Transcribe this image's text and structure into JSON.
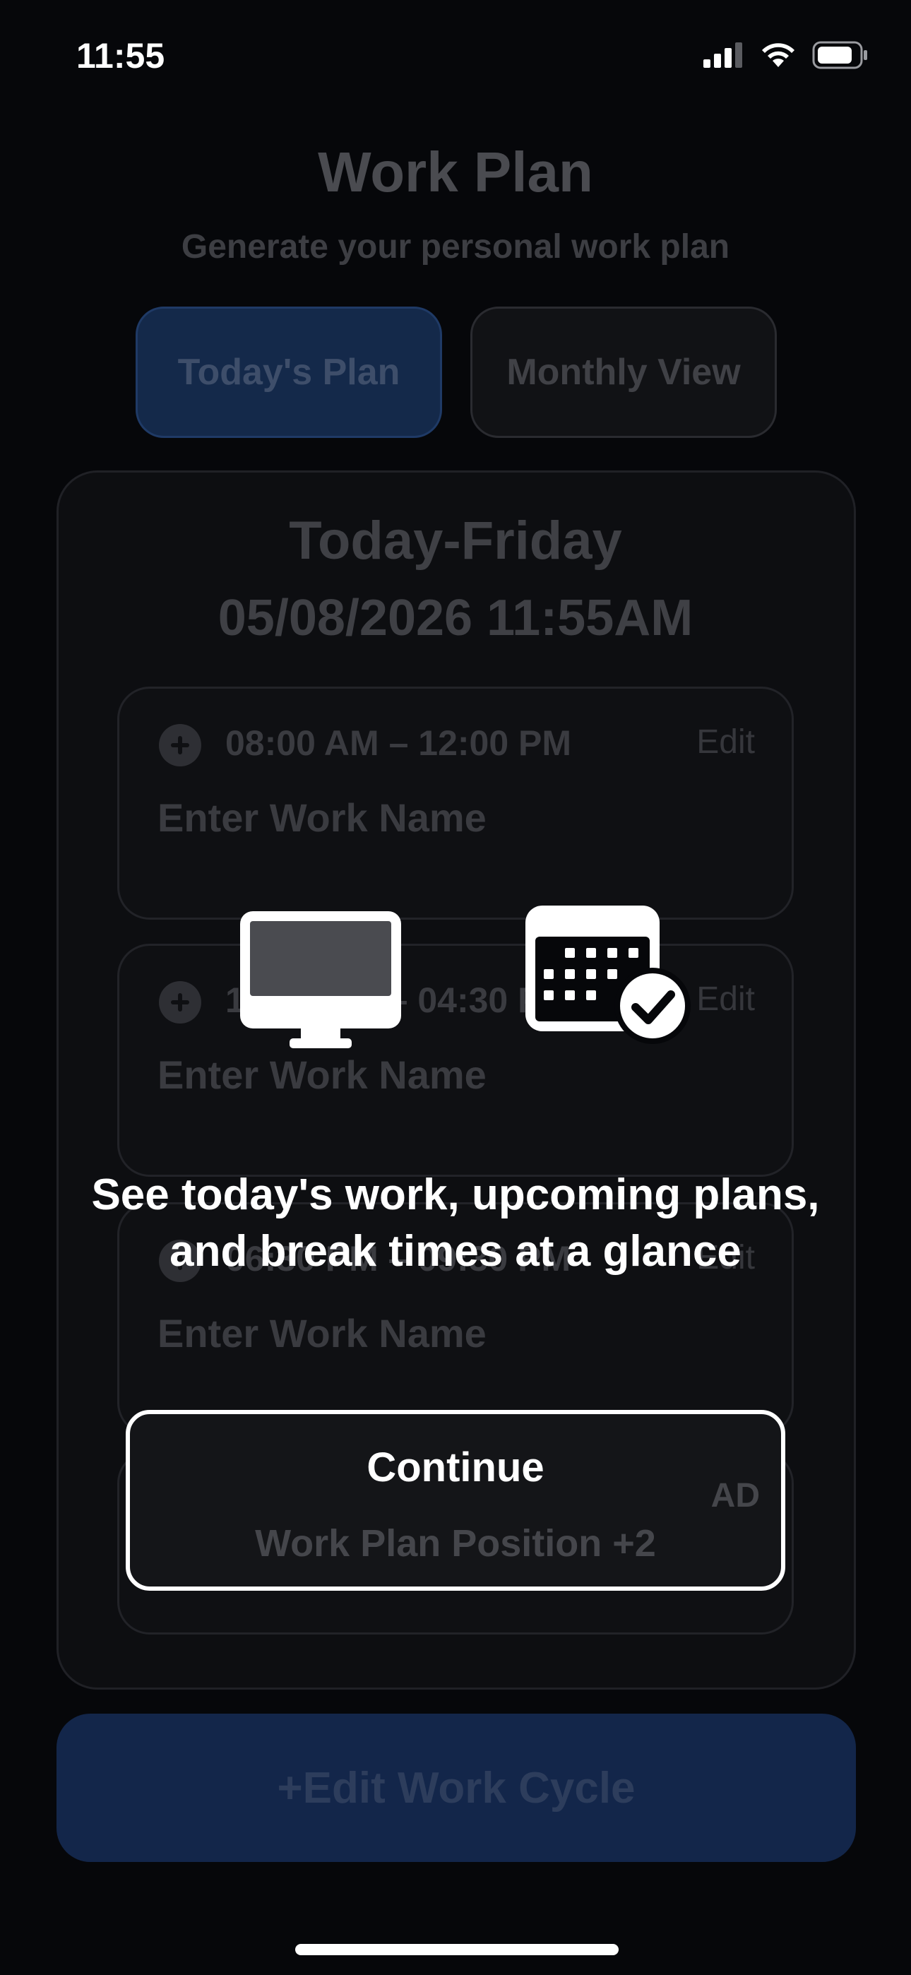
{
  "status_bar": {
    "time": "11:55"
  },
  "header": {
    "title": "Work Plan",
    "subtitle": "Generate your personal work plan"
  },
  "tabs": [
    {
      "label": "Today's Plan",
      "active": true
    },
    {
      "label": "Monthly View",
      "active": false
    }
  ],
  "today": {
    "day": "Today-Friday",
    "datetime": "05/08/2026 11:55AM"
  },
  "slots": [
    {
      "time": "08:00 AM – 12:00 PM",
      "edit": "Edit",
      "name_placeholder": "Enter Work Name"
    },
    {
      "time": "12:30 PM – 04:30 PM",
      "edit": "Edit",
      "name_placeholder": "Enter Work Name"
    },
    {
      "time": "06:30 PM – 09:30 PM",
      "edit": "Edit",
      "name_placeholder": "Enter Work Name"
    }
  ],
  "bottom_button": {
    "label": "+Edit Work Cycle"
  },
  "overlay": {
    "message_line1": "See today's work, upcoming plans,",
    "message_line2": "and break times at a glance",
    "continue_label": "Continue",
    "continue_sub": "Work Plan Position +2",
    "ad_badge": "AD"
  },
  "icons": {
    "plus": "plus-circle-icon",
    "monitor": "desktop-monitor-icon",
    "calendar": "calendar-check-icon",
    "signal": "cellular-signal-icon",
    "wifi": "wifi-icon",
    "battery": "battery-icon"
  },
  "colors": {
    "background": "#06070a",
    "accent_blue": "#14294a",
    "overlay_text": "#ffffff"
  }
}
